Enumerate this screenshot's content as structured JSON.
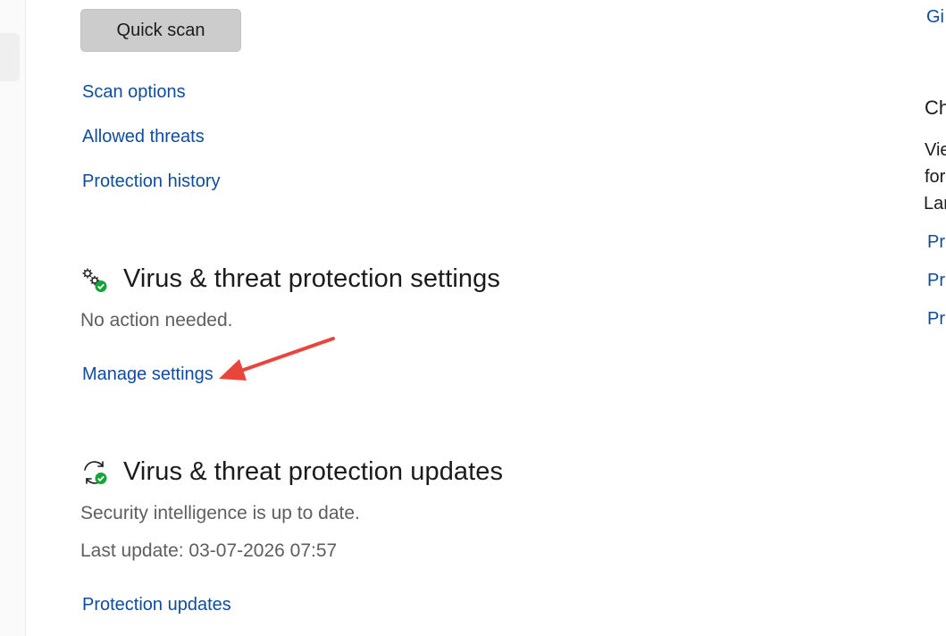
{
  "scan": {
    "quick_scan_label": "Quick scan",
    "links": [
      "Scan options",
      "Allowed threats",
      "Protection history"
    ]
  },
  "settings_section": {
    "icon": "gear-check-icon",
    "title": "Virus & threat protection settings",
    "status": "No action needed.",
    "link": "Manage settings"
  },
  "updates_section": {
    "icon": "refresh-check-icon",
    "title": "Virus & threat protection updates",
    "status": "Security intelligence is up to date.",
    "last_update": "Last update: 03-07-2026 07:57",
    "link": "Protection updates"
  },
  "right_panel": {
    "top_link": "Gi",
    "heading": "Ch",
    "text_lines": [
      "Vie",
      "for",
      "Lar"
    ],
    "links": [
      "Pri",
      "Pri",
      "Pri"
    ]
  },
  "colors": {
    "link": "#0f4c9c",
    "status_ok": "#16a33a",
    "annotation_arrow": "#e8453c"
  }
}
